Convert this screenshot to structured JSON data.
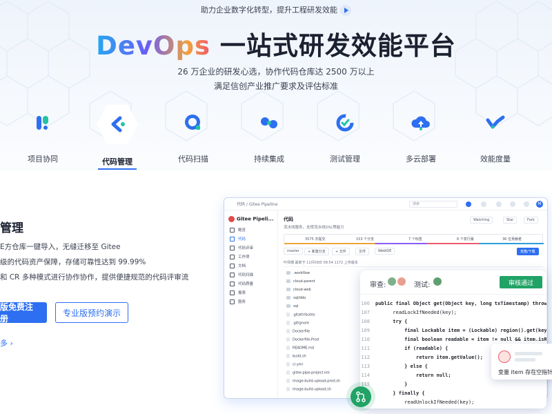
{
  "hero": {
    "tagline": "助力企业数字化转型，提升工程研发效能",
    "title_brand": "DevOps",
    "title_rest": " 一站式研发效能平台",
    "subtitle_line1": "26 万企业的研发心选，协作代码仓库达 2500 万以上",
    "subtitle_line2": "满足信创产业推广要求及评估标准"
  },
  "products": [
    {
      "label": "项目协同",
      "icon": "project-collab-icon"
    },
    {
      "label": "代码管理",
      "icon": "code-manage-icon",
      "active": true
    },
    {
      "label": "代码扫描",
      "icon": "code-scan-icon"
    },
    {
      "label": "持续集成",
      "icon": "ci-icon"
    },
    {
      "label": "测试管理",
      "icon": "test-manage-icon"
    },
    {
      "label": "多云部署",
      "icon": "multi-cloud-icon"
    },
    {
      "label": "效能度量",
      "icon": "metrics-icon"
    }
  ],
  "section": {
    "title": "管理",
    "line1": "E方仓库一键导入，无缝迁移至 Gitee",
    "line2": "级的代码资产保障，存储可靠性达到 99.99%",
    "line3": "和 CR 多种模式进行协作协作，提供便捷规范的代码评审流",
    "btn_primary": "版免费注册",
    "btn_outline": "专业版预约演示",
    "more": "多"
  },
  "mockup": {
    "breadcrumb": "代码 / Gitee Pipeline",
    "search_placeholder": "搜索",
    "avatar": "M",
    "repo_name": "Gitee Pipeli...",
    "sidebar": [
      "概览",
      "代码",
      "代码评审",
      "工作项",
      "文档",
      "代码扫描",
      "代码质量",
      "报表",
      "服务"
    ],
    "repo_title": "代码",
    "repo_desc": "流水线服务，支撑流水线DSL等能力",
    "actions": [
      "Watching",
      "Star",
      "Fork"
    ],
    "stats": [
      "3575 次提交",
      "153 个分支",
      "7 个标签",
      "6 个发行版",
      "36 位贡献者"
    ],
    "toolbar": [
      "master",
      "+ 新建分支",
      "+ 文件",
      "文件",
      "WebIDE",
      "克隆/下载"
    ],
    "commit": "叶师傅 最新于 11月09日 09:54  1172 上传版本",
    "files": [
      ".workflow",
      "cloud-parent",
      "cloud-web",
      "sql/ddo",
      "sql",
      ".gitattributes",
      ".gitignore",
      "Dockerfile",
      "Dockerfile-Prod",
      "README.md",
      "build.sh",
      "ci.yml",
      "gitee-pipe-project.iml",
      "image-build-upload-prod.sh",
      "image-build-upload.sh"
    ]
  },
  "review": {
    "review_label": "审查:",
    "test_label": "测试:",
    "approve": "审核通过",
    "lines": [
      {
        "n": "106",
        "code": "public final Object get(Object key, long txTimestamp) throws"
      },
      {
        "n": "107",
        "code": "      readLockIfNeeded(key);"
      },
      {
        "n": "108",
        "code": "      try {"
      },
      {
        "n": "109",
        "code": "          final Lockable item = (Lockable) region().get(key);"
      },
      {
        "n": "110",
        "code": "          final boolean readable = item != null && item.isReadable"
      },
      {
        "n": "111",
        "code": "          if (readable) {"
      },
      {
        "n": "112",
        "code": "              return item.getValue();"
      },
      {
        "n": "113",
        "code": "          } else {"
      },
      {
        "n": "114",
        "code": "              return null;"
      },
      {
        "n": "115",
        "code": "          }"
      },
      {
        "n": "116",
        "code": "      } finally {"
      },
      {
        "n": "117",
        "code": "          readUnlockIfNeeded(key);"
      }
    ],
    "comment": "变量 item 存在空指针"
  },
  "colors": {
    "accent": "#2d6ff0",
    "success": "#21a366"
  }
}
